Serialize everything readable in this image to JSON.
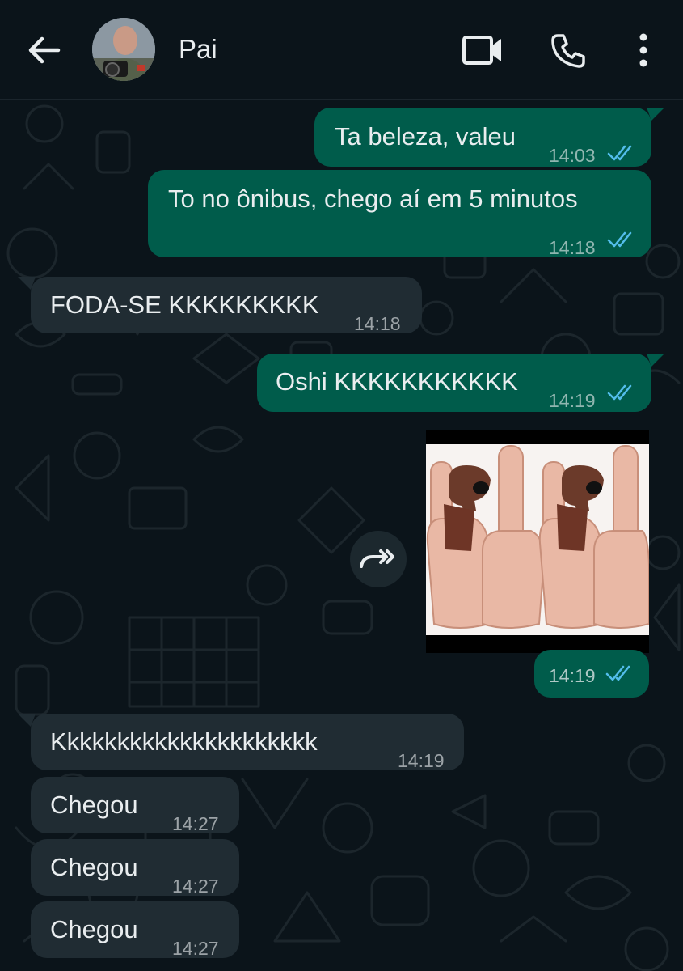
{
  "contact": {
    "name": "Pai",
    "avatar": "avatar"
  },
  "header_icons": [
    "back-arrow-icon",
    "video-call-icon",
    "voice-call-icon",
    "more-options-icon"
  ],
  "messages": [
    {
      "direction": "outgoing",
      "text": "Ta beleza, valeu",
      "time": "14:03",
      "status": "read"
    },
    {
      "direction": "outgoing",
      "text": "To no ônibus, chego aí em 5 minutos",
      "time": "14:18",
      "status": "read"
    },
    {
      "direction": "incoming",
      "text": "FODA-SE KKKKKKKKK",
      "time": "14:18"
    },
    {
      "direction": "outgoing",
      "text": "Oshi KKKKKKKKKKK",
      "time": "14:19",
      "status": "read"
    },
    {
      "direction": "outgoing",
      "type": "sticker",
      "time": "14:19",
      "status": "read"
    },
    {
      "direction": "incoming",
      "text": "Kkkkkkkkkkkkkkkkkkkkk",
      "time": "14:19"
    },
    {
      "direction": "incoming",
      "text": "Chegou",
      "time": "14:27"
    },
    {
      "direction": "incoming",
      "text": "Chegou",
      "time": "14:27"
    },
    {
      "direction": "incoming",
      "text": "Chegou",
      "time": "14:27"
    }
  ],
  "colors": {
    "background": "#0b141a",
    "outgoing_bubble": "#005c4b",
    "incoming_bubble": "#202c33",
    "read_ticks": "#53bdeb",
    "text": "#e9edef"
  }
}
